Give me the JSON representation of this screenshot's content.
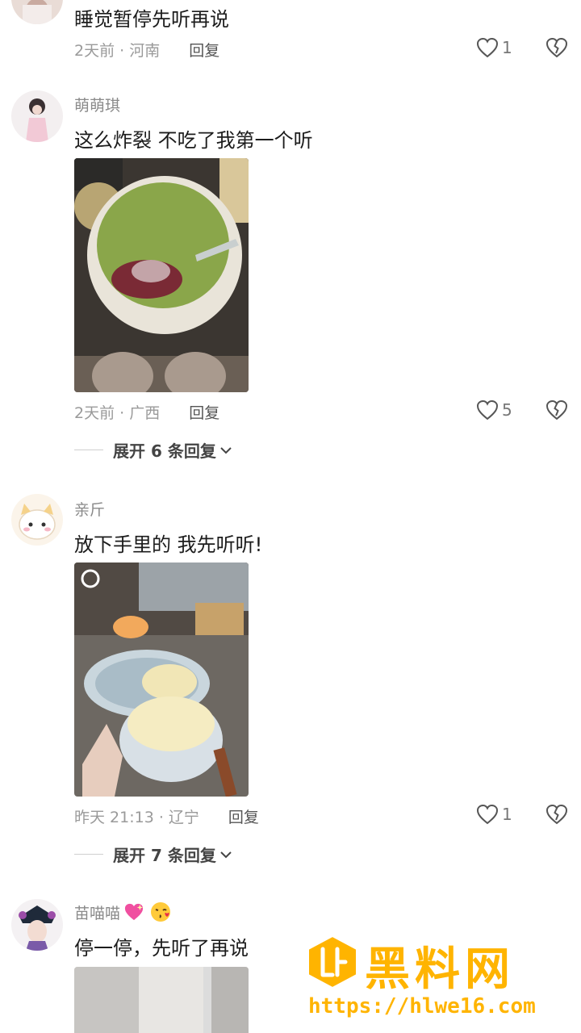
{
  "comments": [
    {
      "text": "睡觉暂停先听再说",
      "time_location": "2天前 · 河南",
      "reply_label": "回复",
      "likes": "1"
    },
    {
      "username": "萌萌琪",
      "text": "这么炸裂 不吃了我第一个听",
      "time_location": "2天前 · 广西",
      "reply_label": "回复",
      "likes": "5",
      "expand_label": "展开 6 条回复"
    },
    {
      "username": "亲斤",
      "text": "放下手里的 我先听听!",
      "time_location": "昨天 21:13 · 辽宁",
      "reply_label": "回复",
      "likes": "1",
      "expand_label": "展开 7 条回复"
    },
    {
      "username": "苗喵喵",
      "text": "停一停，先听了再说"
    }
  ],
  "watermark": {
    "title": "黑料网",
    "url": "https://hlwe16.com"
  },
  "icons": {
    "like": "heart-outline-icon",
    "dislike": "broken-heart-icon",
    "expand": "chevron-down-icon",
    "emoji_1": "sparkling-heart-emoji",
    "emoji_2": "kissing-face-emoji"
  },
  "colors": {
    "watermark": "#ffb400",
    "meta_text": "#9a9a9a",
    "body_text": "#1c1c1c"
  }
}
